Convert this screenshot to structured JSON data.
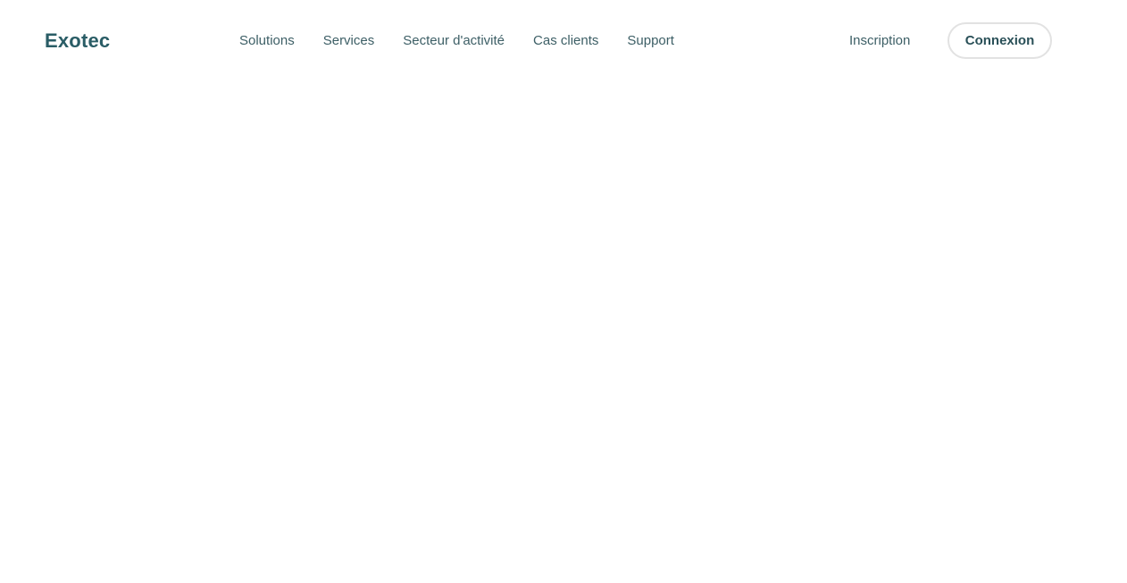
{
  "header": {
    "logo": "Exotec",
    "nav": [
      {
        "label": "Solutions"
      },
      {
        "label": "Services"
      },
      {
        "label": "Secteur d'activité"
      },
      {
        "label": "Cas clients"
      },
      {
        "label": "Support"
      }
    ],
    "signup_label": "Inscription",
    "login_label": "Connexion"
  },
  "colors": {
    "brand": "#2a5d66",
    "nav_text": "#3d5f66",
    "button_border": "#e2e2e2",
    "background": "#ffffff"
  }
}
